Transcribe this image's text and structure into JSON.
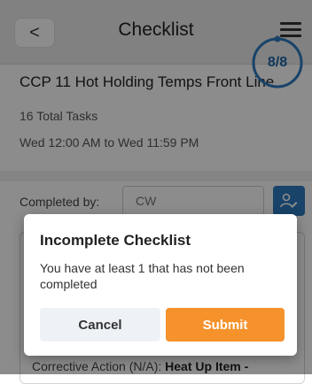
{
  "header": {
    "back_label": "<",
    "title": "Checklist",
    "menu_icon": "hamburger-menu-icon"
  },
  "checklist": {
    "name": "CCP 11 Hot Holding Temps Front Line",
    "total_tasks": "16 Total Tasks",
    "time_range": "Wed 12:00 AM to Wed 11:59 PM",
    "progress_completed": "8",
    "progress_separator": "/",
    "progress_total": "8",
    "progress_fraction": 1.0
  },
  "completed_by": {
    "label": "Completed by:",
    "value": "CW",
    "edit_icon": "edit-user-icon"
  },
  "task_row": {
    "label": "Corrective Action (N/A):",
    "value": "Heat Up Item -"
  },
  "dialog": {
    "title": "Incomplete Checklist",
    "message": "You have at least 1 that has not been completed",
    "cancel_label": "Cancel",
    "submit_label": "Submit"
  },
  "colors": {
    "accent_blue": "#2e7bbf",
    "progress_text": "#1e66a8",
    "submit_orange": "#f5922b",
    "overlay": "rgba(0,0,0,0.45)"
  }
}
